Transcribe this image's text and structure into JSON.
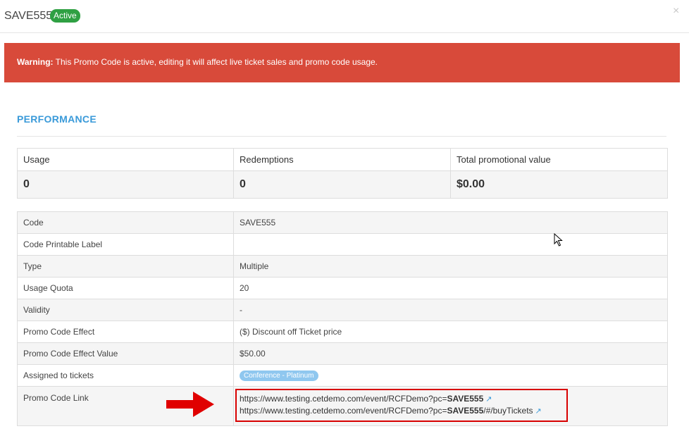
{
  "header": {
    "title": "SAVE555",
    "status_badge": "Active",
    "close_label": "×"
  },
  "alert": {
    "strong": "Warning:",
    "message": " This Promo Code is active, editing it will affect live ticket sales and promo code usage."
  },
  "performance": {
    "title": "PERFORMANCE",
    "headers": [
      "Usage",
      "Redemptions",
      "Total promotional value"
    ],
    "values": [
      "0",
      "0",
      "$0.00"
    ]
  },
  "details": [
    {
      "label": "Code",
      "value": "SAVE555"
    },
    {
      "label": "Code Printable Label",
      "value": ""
    },
    {
      "label": "Type",
      "value": "Multiple"
    },
    {
      "label": "Usage Quota",
      "value": "20"
    },
    {
      "label": "Validity",
      "value": " -"
    },
    {
      "label": "Promo Code Effect",
      "value": "($) Discount off Ticket price"
    },
    {
      "label": "Promo Code Effect Value",
      "value": "$50.00"
    },
    {
      "label": "Assigned to tickets",
      "value": "Conference - Platinum"
    },
    {
      "label": "Promo Code Link",
      "value": ""
    }
  ],
  "links": [
    {
      "prefix": "https://www.testing.cetdemo.com/event/RCFDemo?pc=",
      "code": "SAVE555",
      "suffix": "",
      "icon": "external-link-icon"
    },
    {
      "prefix": "https://www.testing.cetdemo.com/event/RCFDemo?pc=",
      "code": "SAVE555",
      "suffix": "/#/buyTickets",
      "icon": "external-link-icon"
    }
  ],
  "colors": {
    "alert_bg": "#d84a3a",
    "badge_active": "#2fa043",
    "section_title": "#3a9ad9",
    "highlight_box": "#d80000",
    "ticket_tag": "#8fc7ef"
  }
}
